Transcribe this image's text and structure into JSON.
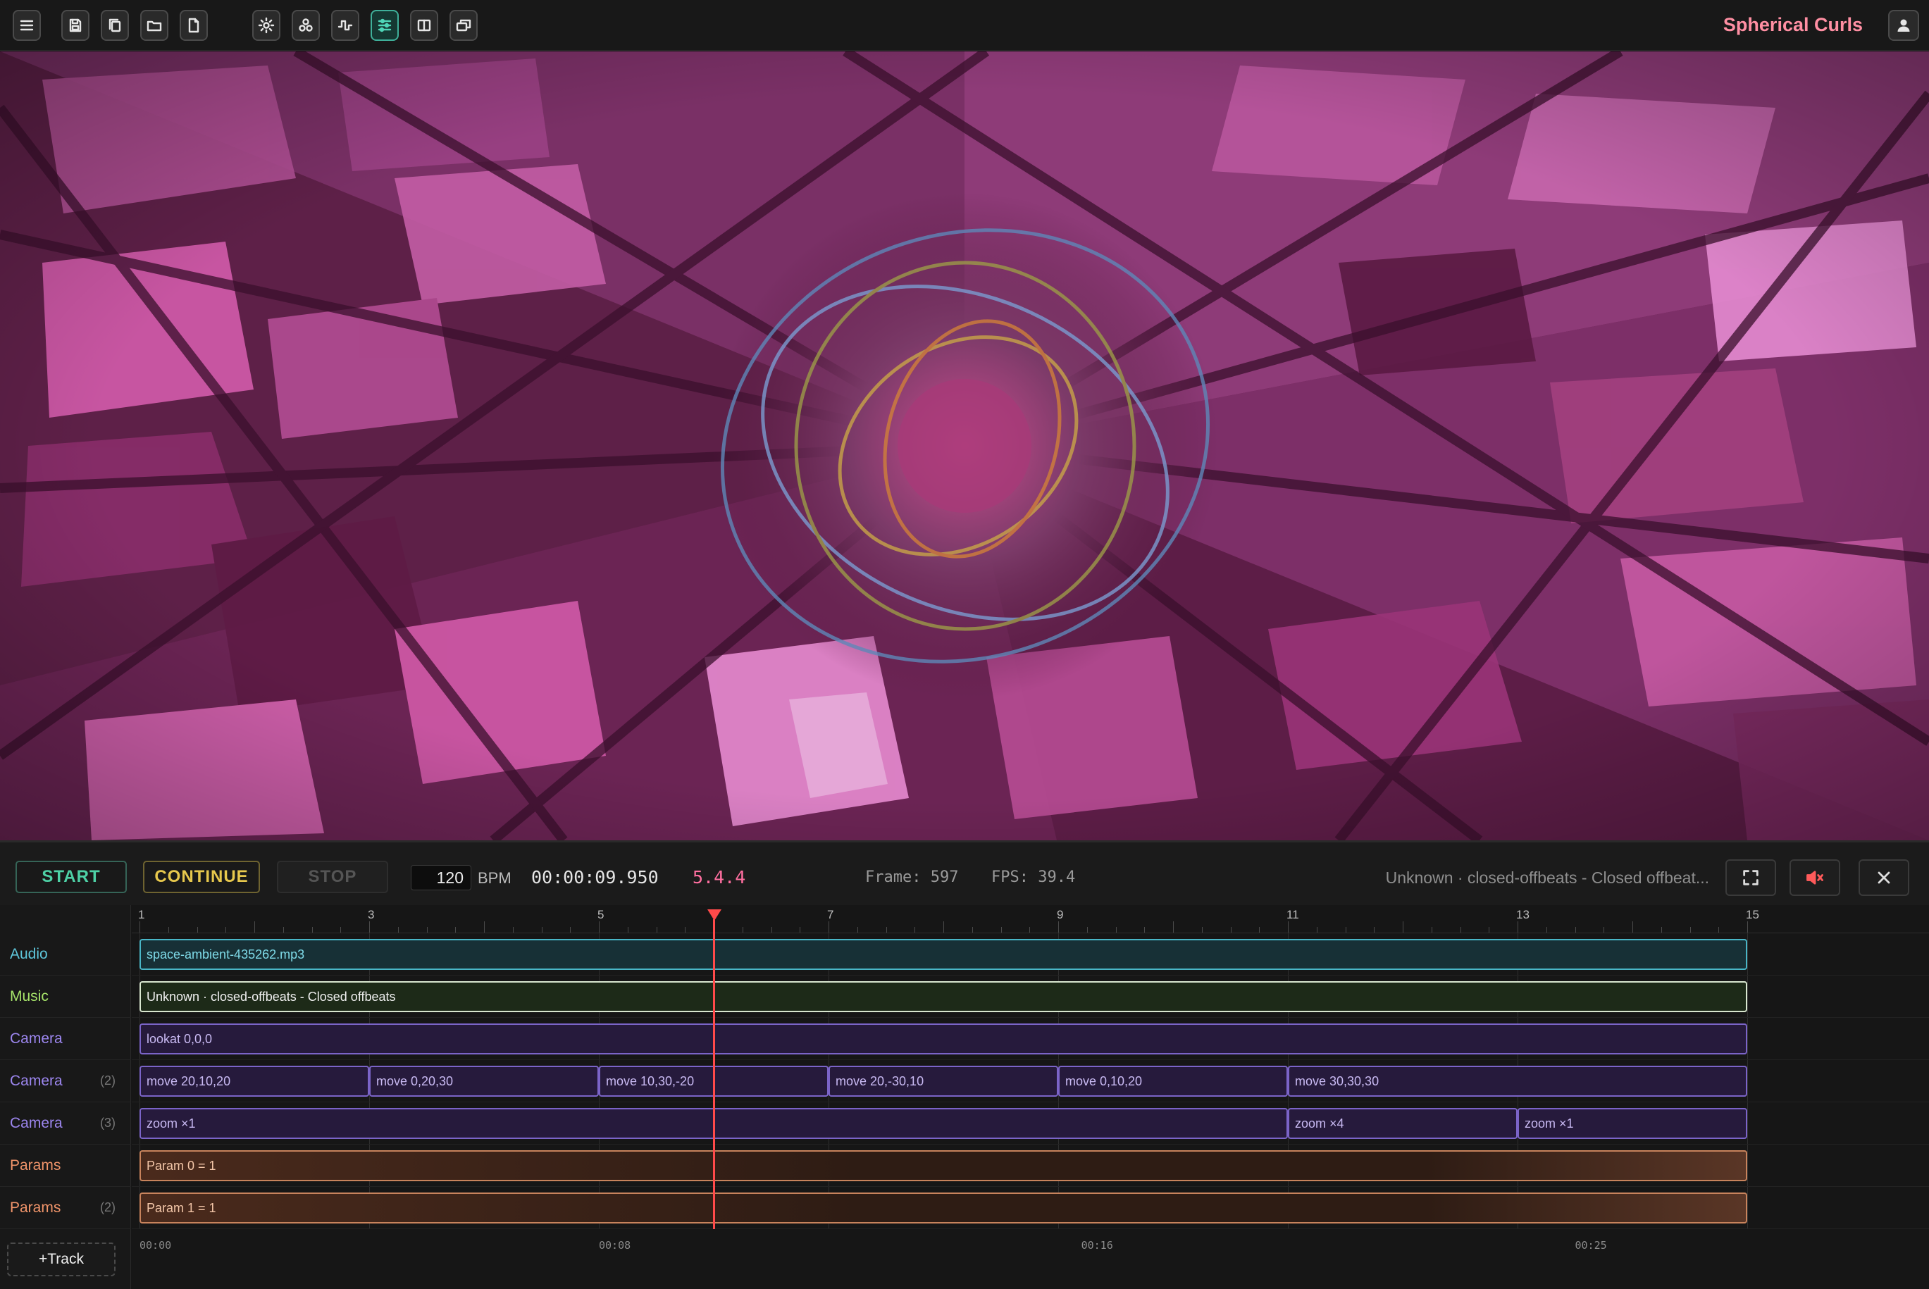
{
  "app": {
    "title": "Spherical Curls"
  },
  "toolbar": {
    "buttons": [
      {
        "name": "menu-icon"
      },
      {
        "name": "save-icon"
      },
      {
        "name": "copy-icon"
      },
      {
        "name": "folder-open-icon"
      },
      {
        "name": "file-icon"
      },
      {
        "name": "gear-icon"
      },
      {
        "name": "molecule-icon"
      },
      {
        "name": "waveform-icon"
      },
      {
        "name": "sliders-icon",
        "active": true
      },
      {
        "name": "layout-icon"
      },
      {
        "name": "windows-icon"
      }
    ],
    "user": {
      "icon": "user-icon"
    }
  },
  "transport": {
    "start": "START",
    "continue": "CONTINUE",
    "stop": "STOP",
    "bpm_value": "120",
    "bpm_label": "BPM",
    "time": "00:00:09.950",
    "beat": "5.4.4",
    "frame": "Frame: 597",
    "fps": "FPS: 39.4",
    "track_info": "Unknown · closed-offbeats - Closed offbeat...",
    "fullscreen_icon": "fullscreen-icon",
    "mute_icon": "speaker-muted-icon",
    "close_icon": "close-icon"
  },
  "timeline": {
    "bar_numbers": [
      "1",
      "3",
      "5",
      "7",
      "9",
      "11",
      "13",
      "15"
    ],
    "time_labels": [
      "00:00",
      "00:08",
      "00:16",
      "00:25"
    ],
    "playhead_bar": 6.0,
    "tracks": [
      {
        "label": "Audio",
        "index": "",
        "color": "#5ec6da",
        "type": "audio",
        "clips": [
          {
            "text": "space-ambient-435262.mp3",
            "start": 1,
            "end": 15
          }
        ]
      },
      {
        "label": "Music",
        "index": "",
        "color": "#a6e36a",
        "type": "music",
        "clips": [
          {
            "text": "Unknown · closed-offbeats - Closed offbeats",
            "start": 1,
            "end": 15
          }
        ]
      },
      {
        "label": "Camera",
        "index": "",
        "color": "#9c86ee",
        "type": "cam",
        "clips": [
          {
            "text": "lookat 0,0,0",
            "start": 1,
            "end": 15
          }
        ]
      },
      {
        "label": "Camera",
        "index": "(2)",
        "color": "#9c86ee",
        "type": "cam",
        "clips": [
          {
            "text": "move  20,10,20",
            "start": 1,
            "end": 3
          },
          {
            "text": "move  0,20,30",
            "start": 3,
            "end": 5
          },
          {
            "text": "move  10,30,-20",
            "start": 5,
            "end": 7
          },
          {
            "text": "move  20,-30,10",
            "start": 7,
            "end": 9
          },
          {
            "text": "move  0,10,20",
            "start": 9,
            "end": 11
          },
          {
            "text": "move  30,30,30",
            "start": 11,
            "end": 15
          }
        ]
      },
      {
        "label": "Camera",
        "index": "(3)",
        "color": "#9c86ee",
        "type": "cam",
        "clips": [
          {
            "text": "zoom  ×1",
            "start": 1,
            "end": 11
          },
          {
            "text": "zoom  ×4",
            "start": 11,
            "end": 13
          },
          {
            "text": "zoom  ×1",
            "start": 13,
            "end": 15
          }
        ]
      },
      {
        "label": "Params",
        "index": "",
        "color": "#f0946a",
        "type": "param",
        "clips": [
          {
            "text": "Param 0 = 1",
            "start": 1,
            "end": 15
          }
        ]
      },
      {
        "label": "Params",
        "index": "(2)",
        "color": "#f0946a",
        "type": "param",
        "clips": [
          {
            "text": "Param 1 = 1",
            "start": 1,
            "end": 15
          }
        ]
      }
    ],
    "add_track": "+Track"
  }
}
